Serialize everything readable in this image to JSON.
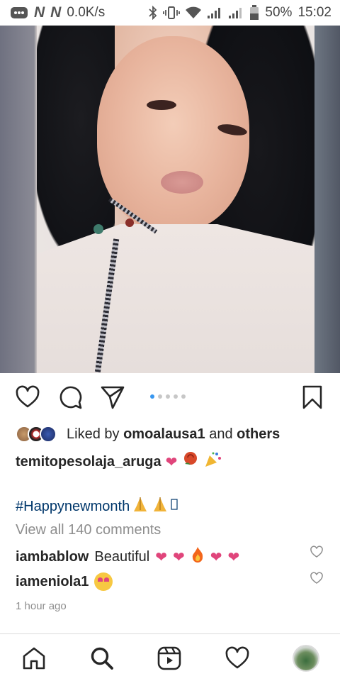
{
  "status_bar": {
    "network_speed": "0.0K/s",
    "battery": "50%",
    "time": "15:02"
  },
  "post": {
    "carousel": {
      "total": 5,
      "active_index": 0
    },
    "liked_prefix": "Liked by",
    "liked_user": "omoalausa1",
    "liked_joiner": "and",
    "liked_suffix": "others",
    "caption_user": "temitopesolaja_aruga",
    "hashtag": "#Happynewmonth",
    "view_all": "View all 140 comments",
    "comments": [
      {
        "user": "iambablow",
        "text": "Beautiful"
      },
      {
        "user": "iameniola1",
        "text": ""
      }
    ],
    "timestamp": "1 hour ago"
  },
  "icons": {
    "like": "heart-outline-icon",
    "comment": "comment-icon",
    "share": "paper-plane-icon",
    "save": "bookmark-icon",
    "home": "home-icon",
    "search": "search-icon",
    "reels": "reels-icon",
    "activity": "heart-outline-icon",
    "profile": "profile-avatar"
  },
  "colors": {
    "link_blue": "#00376b",
    "active_dot": "#3897f0",
    "muted_text": "#8e8e8e"
  }
}
